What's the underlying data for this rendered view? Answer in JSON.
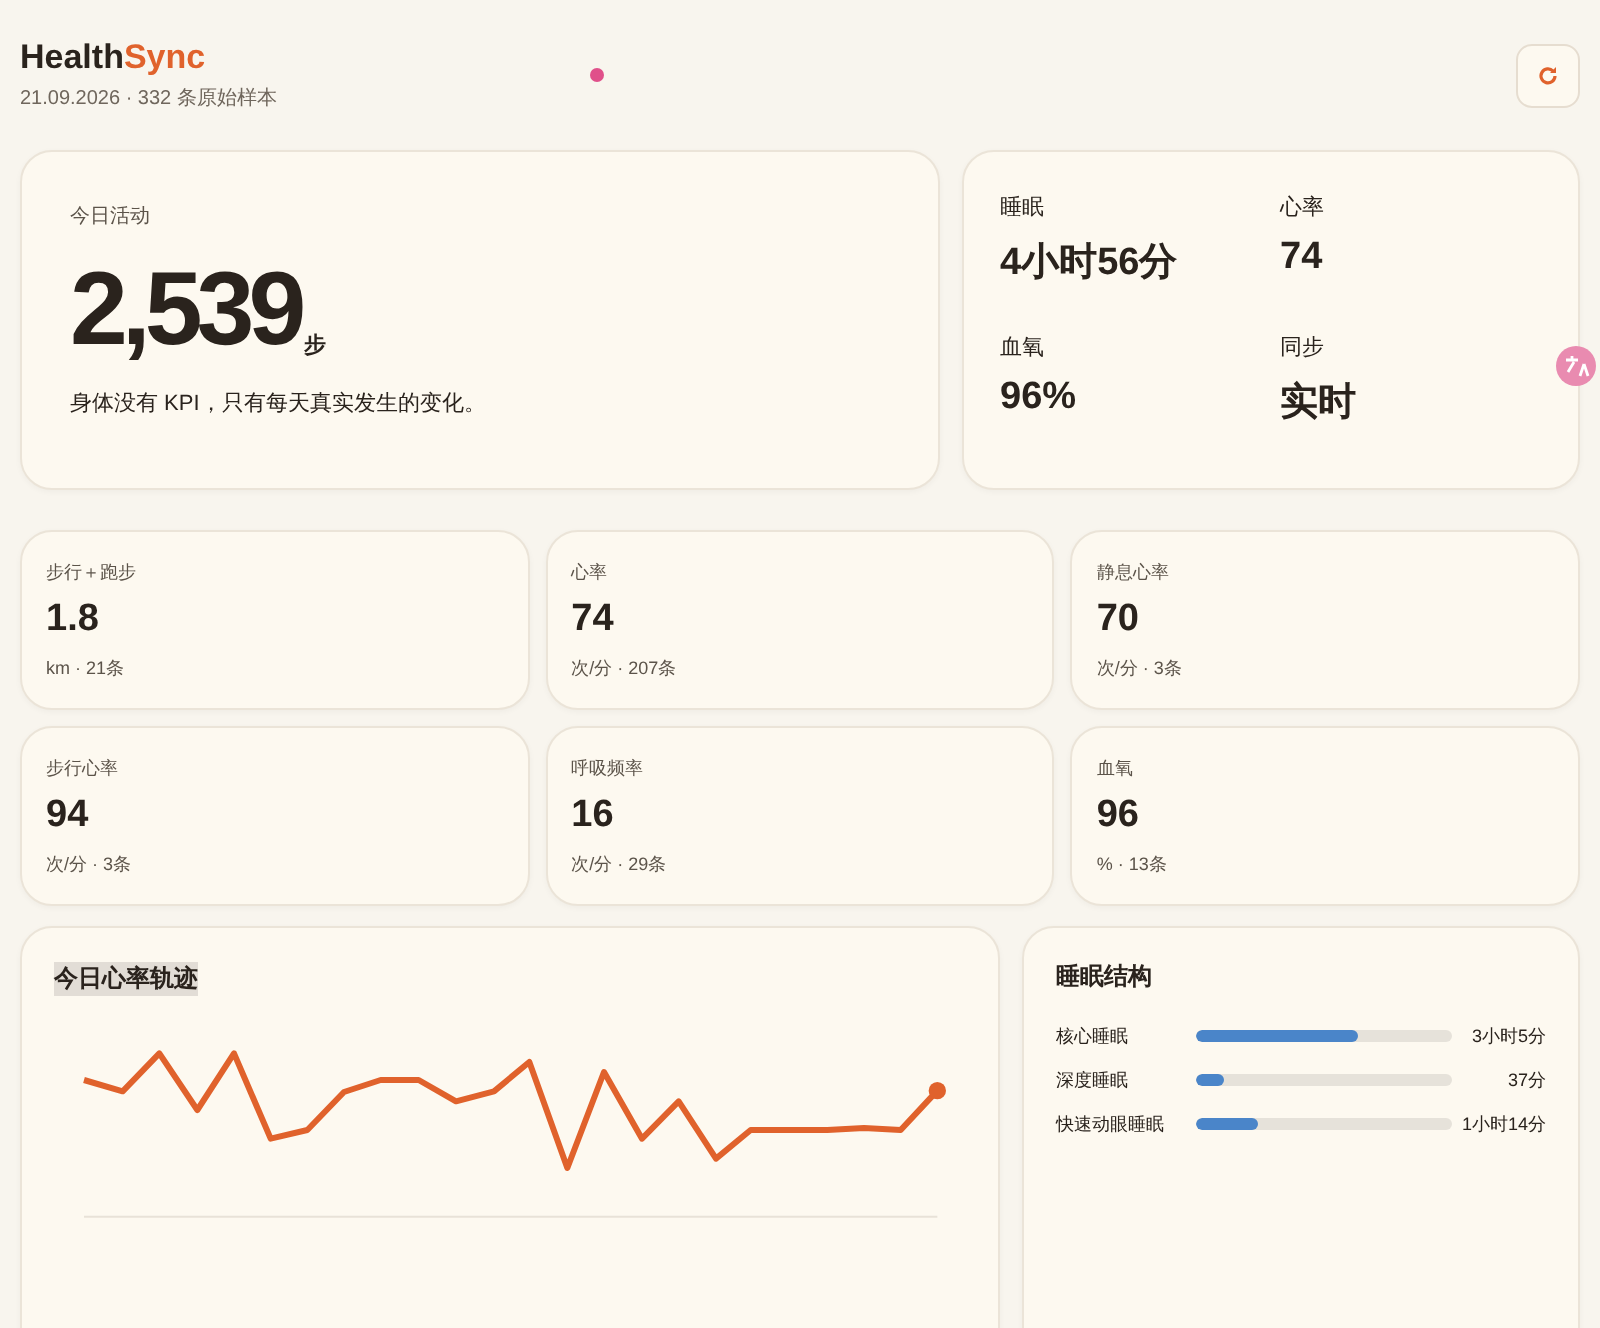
{
  "header": {
    "brand": "Health",
    "brand_accent": "Sync",
    "subtitle": "21.09.2026 · 332 条原始样本"
  },
  "hero": {
    "label": "今日活动",
    "value": "2,539",
    "unit": "步",
    "caption": "身体没有 KPI，只有每天真实发生的变化。"
  },
  "summary": [
    {
      "label": "睡眠",
      "value": "4小时56分"
    },
    {
      "label": "心率",
      "value": "74"
    },
    {
      "label": "血氧",
      "value": "96%"
    },
    {
      "label": "同步",
      "value": "实时"
    }
  ],
  "metrics": [
    {
      "label": "步行＋跑步",
      "value": "1.8",
      "detail": "km · 21条"
    },
    {
      "label": "心率",
      "value": "74",
      "detail": "次/分 · 207条"
    },
    {
      "label": "静息心率",
      "value": "70",
      "detail": "次/分 · 3条"
    },
    {
      "label": "步行心率",
      "value": "94",
      "detail": "次/分 · 3条"
    },
    {
      "label": "呼吸频率",
      "value": "16",
      "detail": "次/分 · 29条"
    },
    {
      "label": "血氧",
      "value": "96",
      "detail": "% · 13条"
    }
  ],
  "heart_trace": {
    "title": "今日心率轨迹"
  },
  "sleep": {
    "title": "睡眠结构",
    "stages": [
      {
        "name": "核心睡眠",
        "level": 0.63,
        "reading": "3小时5分"
      },
      {
        "name": "深度睡眠",
        "level": 0.11,
        "reading": "37分"
      },
      {
        "name": "快速动眼睡眠",
        "level": 0.24,
        "reading": "1小时14分"
      }
    ]
  }
}
